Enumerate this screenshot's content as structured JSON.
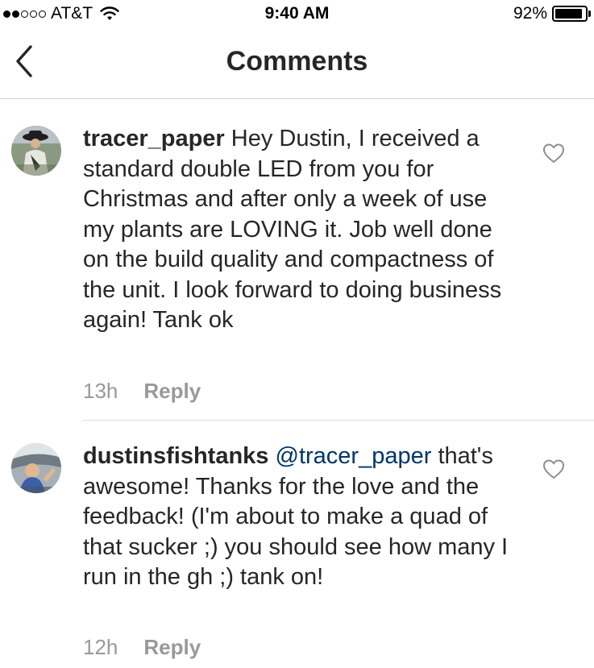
{
  "status_bar": {
    "signal_full": 2,
    "signal_total": 5,
    "carrier": "AT&T",
    "time": "9:40 AM",
    "battery_percent": "92%",
    "battery_level": 0.92
  },
  "nav": {
    "back_icon": "chevron-left-icon",
    "title": "Comments"
  },
  "comments": [
    {
      "username": "tracer_paper",
      "mention": "",
      "text": "Hey Dustin, I received a standard double LED from you for Christmas and after only a week of use my plants are LOVING it. Job well done on the build quality and compactness of the unit. I look forward to doing business again! Tank ok",
      "time": "13h",
      "reply_label": "Reply",
      "like_icon": "heart-outline-icon",
      "avatar_colors": [
        "#6b7a5c",
        "#c9c3b5",
        "#2f3a2a"
      ]
    },
    {
      "username": "dustinsfishtanks",
      "mention": "@tracer_paper",
      "text": "that's awesome! Thanks for the love and the feedback! (I'm about to make a quad of that sucker ;) you should see how many I run in the gh ;) tank on!",
      "time": "12h",
      "reply_label": "Reply",
      "like_icon": "heart-outline-icon",
      "avatar_colors": [
        "#9aa3ab",
        "#3b5fa8",
        "#e2c29a"
      ]
    }
  ],
  "colors": {
    "text": "#262626",
    "secondary": "#999999",
    "mention": "#003569",
    "divider": "#dbdbdb"
  }
}
